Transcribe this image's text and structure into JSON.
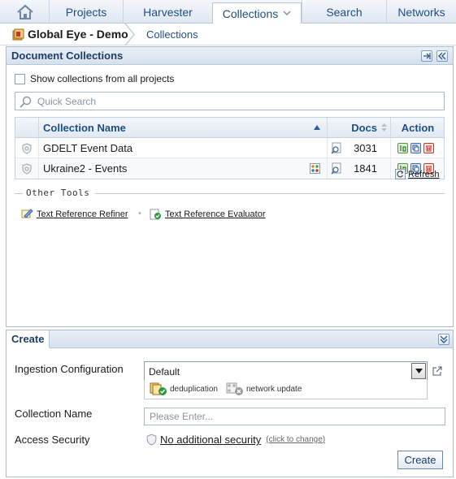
{
  "nav": {
    "tabs": [
      {
        "label": "Projects"
      },
      {
        "label": "Harvester"
      },
      {
        "label": "Collections",
        "active": true
      },
      {
        "label": "Search"
      },
      {
        "label": "Networks"
      }
    ]
  },
  "breadcrumb": {
    "project": "Global Eye - Demo",
    "current": "Collections"
  },
  "collections_panel": {
    "title": "Document Collections",
    "show_all_label": "Show collections from all projects",
    "show_all_checked": false,
    "search_placeholder": "Quick Search",
    "columns": {
      "name": "Collection Name",
      "docs": "Docs",
      "action": "Action"
    },
    "rows": [
      {
        "name": "GDELT Event Data",
        "docs": "3031",
        "has_network_icon": false
      },
      {
        "name": "Ukraine2 - Events",
        "docs": "1841",
        "has_network_icon": true
      }
    ],
    "refresh_label": "Refresh",
    "other_tools_label": "Other Tools",
    "tools": [
      {
        "label": "Text Reference Refiner",
        "icon": "refiner-icon"
      },
      {
        "label": "Text Reference Evaluator",
        "icon": "evaluator-icon"
      }
    ]
  },
  "create_panel": {
    "tab_label": "Create",
    "ingestion_label": "Ingestion Configuration",
    "ingestion_value": "Default",
    "plugins": [
      {
        "label": "deduplication",
        "status": "enabled"
      },
      {
        "label": "network update",
        "status": "disabled"
      }
    ],
    "name_label": "Collection Name",
    "name_placeholder": "Please Enter...",
    "security_label": "Access Security",
    "security_value": "No additional security",
    "security_hint": "(click to change)",
    "create_button": "Create"
  },
  "colors": {
    "accent": "#1d4f86",
    "panel_border": "#a8bcd6",
    "header_bg": "#dfe7f1"
  }
}
